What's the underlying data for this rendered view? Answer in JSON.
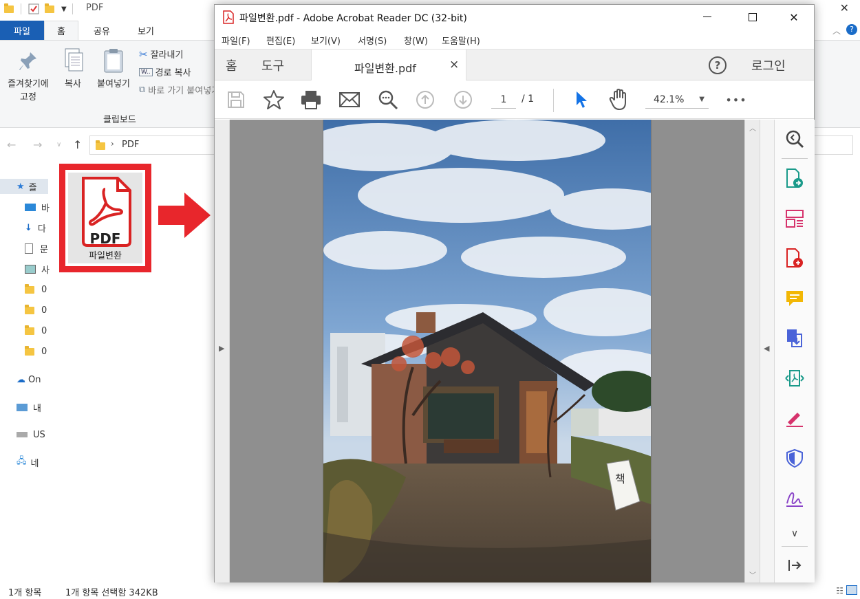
{
  "explorer": {
    "title": "PDF",
    "ribbon_tabs": [
      "파일",
      "홈",
      "공유",
      "보기"
    ],
    "pin_label_line1": "즐겨찾기에",
    "pin_label_line2": "고정",
    "copy_label": "복사",
    "paste_label": "붙여넣기",
    "cut_label": "잘라내기",
    "copy_path_label": "경로 복사",
    "paste_shortcut_label": "바로 가기 붙여넣기",
    "clipboard_group_label": "클립보드",
    "breadcrumb": "PDF",
    "nav_items": [
      "즐",
      "바",
      "다",
      "문",
      "사",
      "0",
      "0",
      "0",
      "0",
      "On",
      "내",
      "US",
      "네"
    ],
    "file_name": "파일변환",
    "file_icon_text": "PDF",
    "status_count": "1개 항목",
    "status_selected": "1개 항목 선택함 342KB"
  },
  "acrobat": {
    "window_title": "파일변환.pdf - Adobe Acrobat Reader DC (32-bit)",
    "menu": [
      "파일(F)",
      "편집(E)",
      "보기(V)",
      "서명(S)",
      "창(W)",
      "도움말(H)"
    ],
    "tab_home": "홈",
    "tab_tools": "도구",
    "doc_tab": "파일변환.pdf",
    "doc_tab_close": "×",
    "help": "?",
    "login": "로그인",
    "page_current": "1",
    "page_total": "/ 1",
    "zoom": "42.1%",
    "more": "•••",
    "sign_text": "책"
  },
  "colors": {
    "explorer_accent": "#1a5fb4",
    "highlight_red": "#e8262c",
    "acrobat_red": "#d92323",
    "pointer_blue": "#1473e6"
  }
}
